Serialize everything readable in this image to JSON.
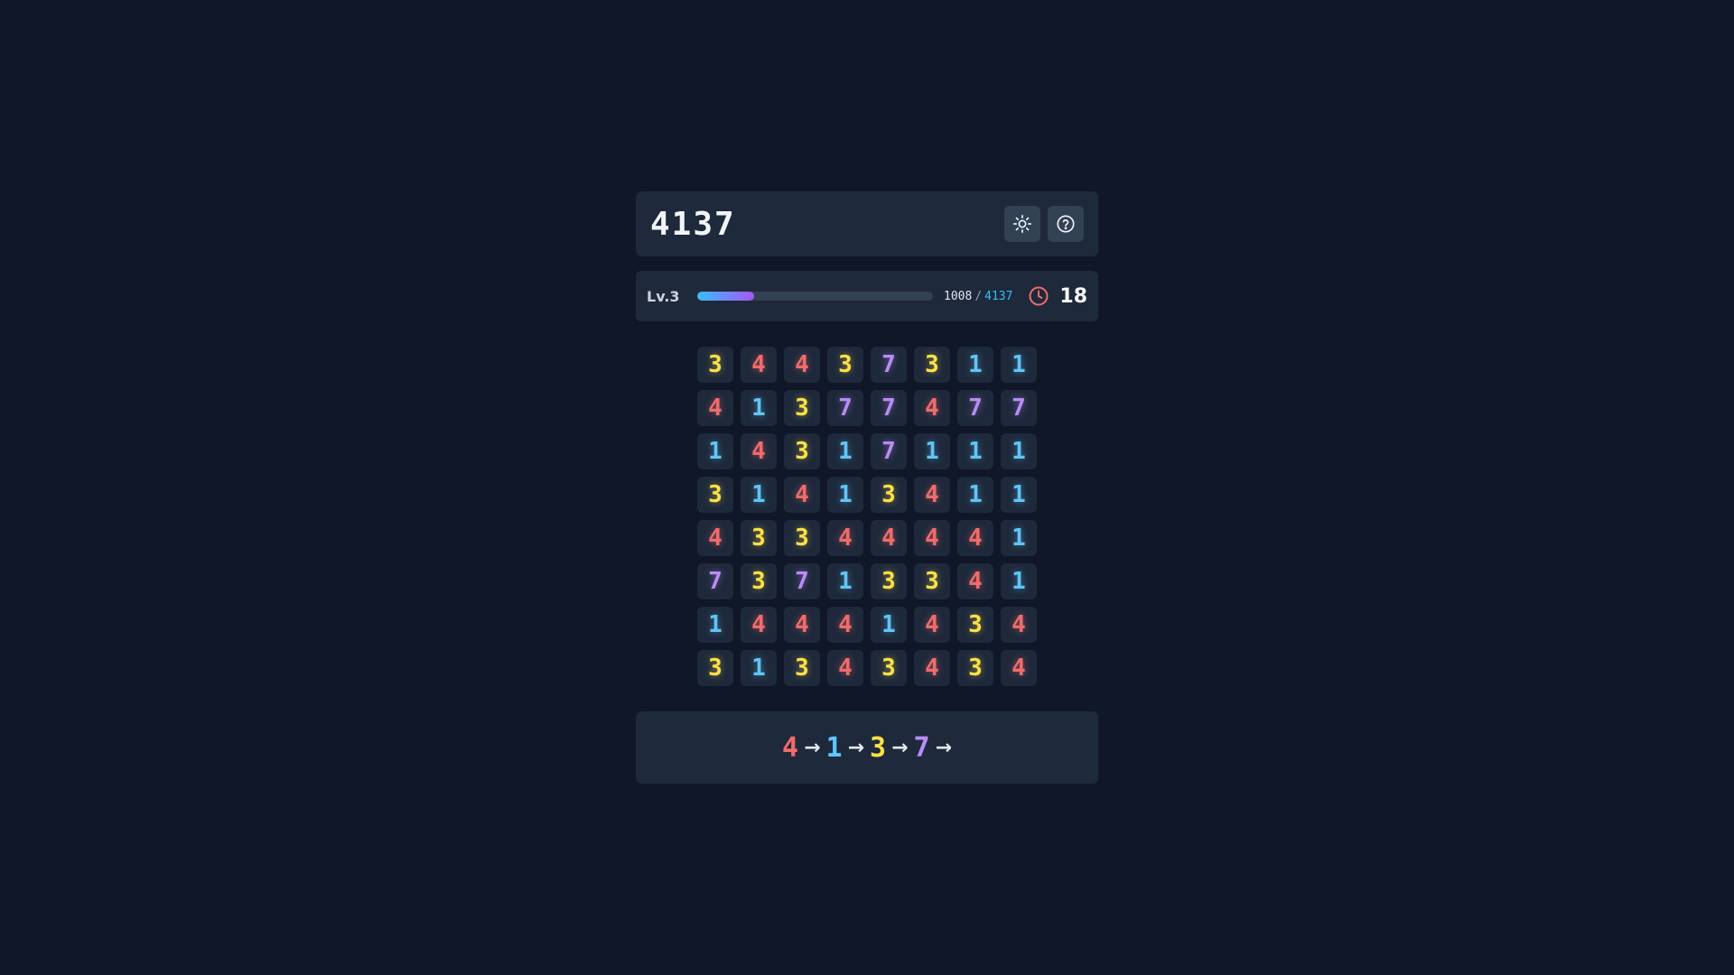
{
  "header": {
    "title": "4137",
    "brightness_icon": "sun-icon",
    "help_icon": "help-circle-icon"
  },
  "status": {
    "level_label": "Lv.3",
    "progress_fraction": 0.24,
    "current_score": "1008",
    "separator": "/",
    "target_score": "4137",
    "timer_icon": "clock-icon",
    "timer_value": "18"
  },
  "colors": {
    "1": "#60c5f7",
    "3": "#fde047",
    "4": "#f06b6b",
    "7": "#b98cf5",
    "background": "#0f1728",
    "panel": "#1e293b"
  },
  "board": [
    [
      "3",
      "4",
      "4",
      "3",
      "7",
      "3",
      "1",
      "1"
    ],
    [
      "4",
      "1",
      "3",
      "7",
      "7",
      "4",
      "7",
      "7"
    ],
    [
      "1",
      "4",
      "3",
      "1",
      "7",
      "1",
      "1",
      "1"
    ],
    [
      "3",
      "1",
      "4",
      "1",
      "3",
      "4",
      "1",
      "1"
    ],
    [
      "4",
      "3",
      "3",
      "4",
      "4",
      "4",
      "4",
      "1"
    ],
    [
      "7",
      "3",
      "7",
      "1",
      "3",
      "3",
      "4",
      "1"
    ],
    [
      "1",
      "4",
      "4",
      "4",
      "1",
      "4",
      "3",
      "4"
    ],
    [
      "3",
      "1",
      "3",
      "4",
      "3",
      "4",
      "3",
      "4"
    ]
  ],
  "sequence": {
    "digits": [
      "4",
      "1",
      "3",
      "7"
    ],
    "arrow": "→"
  }
}
